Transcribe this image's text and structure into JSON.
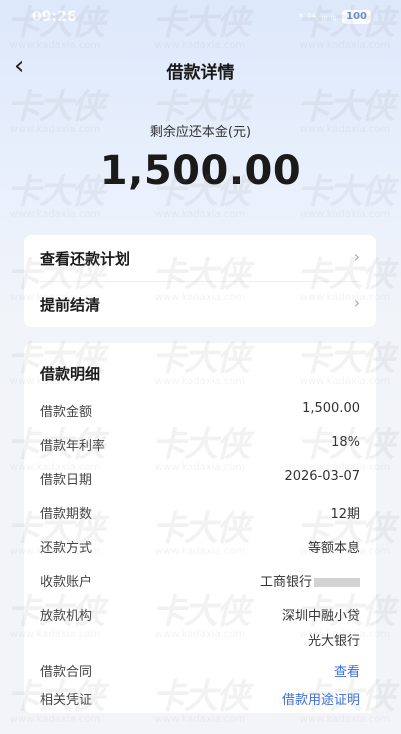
{
  "status_bar": {
    "time": "09:26",
    "icons": "* ⁰⁴ᵢ ᵢₗₗ ᵢₗₗ",
    "battery": "100"
  },
  "nav": {
    "back_icon": "‹",
    "title": "借款详情"
  },
  "summary": {
    "label": "剩余应还本金(元)",
    "amount": "1,500.00"
  },
  "actions": [
    {
      "label": "查看还款计划",
      "chevron": "›"
    },
    {
      "label": "提前结清",
      "chevron": "›"
    }
  ],
  "details": {
    "title": "借款明细",
    "rows": {
      "amount": {
        "label": "借款金额",
        "value": "1,500.00"
      },
      "rate": {
        "label": "借款年利率",
        "value": "18%"
      },
      "date": {
        "label": "借款日期",
        "value": "2026-03-07"
      },
      "term": {
        "label": "借款期数",
        "value": "12期"
      },
      "method": {
        "label": "还款方式",
        "value": "等额本息"
      },
      "account": {
        "label": "收款账户",
        "value": "工商银行"
      },
      "lender": {
        "label": "放款机构",
        "value_line1": "深圳中融小贷",
        "value_line2": "光大银行"
      },
      "contract": {
        "label": "借款合同",
        "value": "查看"
      },
      "voucher": {
        "label": "相关凭证",
        "value": "借款用途证明"
      }
    }
  },
  "watermark": {
    "brand": "卡大侠",
    "site": "www.kadaxia.com"
  },
  "colors": {
    "link": "#3b6fd8",
    "bg_top": "#dde8fb",
    "card": "#ffffff"
  }
}
